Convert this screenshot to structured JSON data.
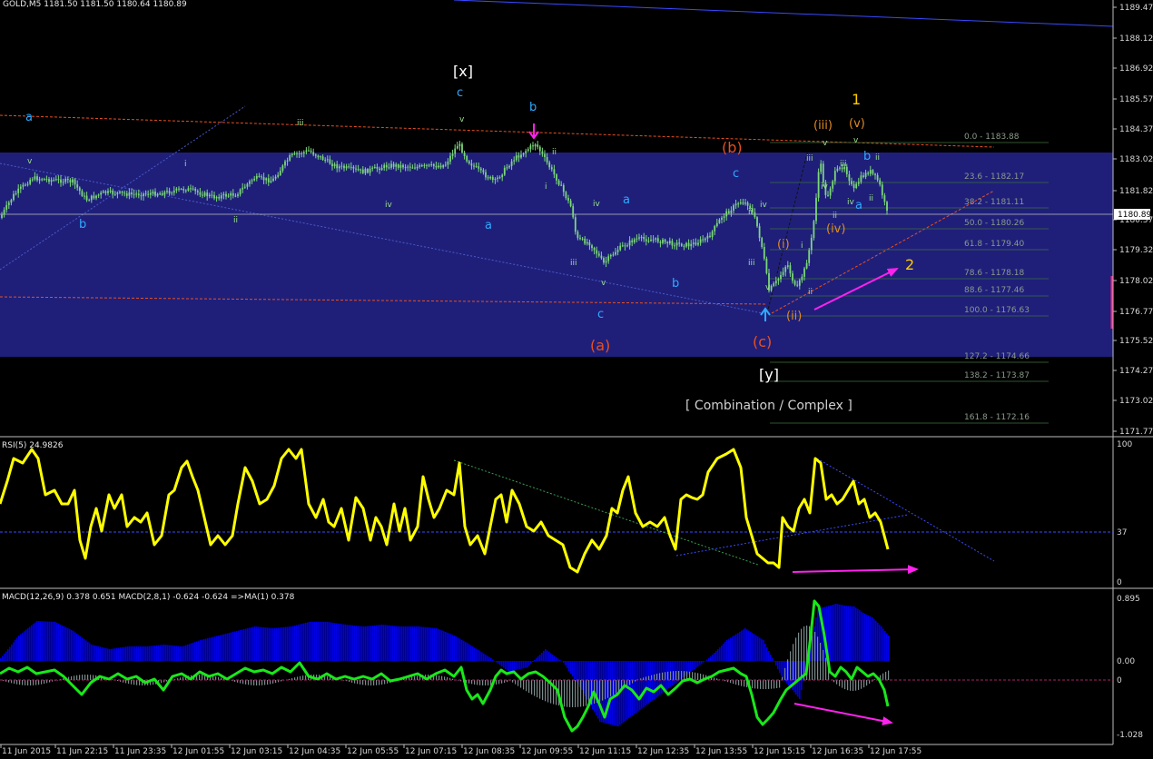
{
  "header": {
    "main": "GOLD,M5  1181.50 1181.50 1180.64 1180.89",
    "rsi": "RSI(5) 24.9826",
    "macd": "MACD(12,26,9) 0.378 0.651  MACD(2,8,1) -0.624 -0.624  =>MA(1) 0.378"
  },
  "price_axis": [
    "1189.47",
    "1188.12",
    "1186.92",
    "1185.57",
    "1184.37",
    "1183.02",
    "1181.82",
    "1180.57",
    "1179.32",
    "1178.02",
    "1176.77",
    "1175.52",
    "1174.27",
    "1173.02",
    "1171.77"
  ],
  "current_price": "1180.89",
  "rsi_axis": [
    "100",
    "37",
    "0"
  ],
  "macd_axis": [
    "0.895",
    "0.00",
    "0",
    "-1.028"
  ],
  "time_axis": [
    "11 Jun 2015",
    "11 Jun 22:15",
    "11 Jun 23:35",
    "12 Jun 01:55",
    "12 Jun 03:15",
    "12 Jun 04:35",
    "12 Jun 05:55",
    "12 Jun 07:15",
    "12 Jun 08:35",
    "12 Jun 09:55",
    "12 Jun 11:15",
    "12 Jun 12:35",
    "12 Jun 13:55",
    "12 Jun 15:15",
    "12 Jun 16:35",
    "12 Jun 17:55"
  ],
  "fib_levels": [
    "0.0 - 1183.88",
    "23.6 - 1182.17",
    "38.2 - 1181.11",
    "50.0 - 1180.26",
    "61.8 - 1179.40",
    "78.6 - 1178.18",
    "88.6 - 1177.46",
    "100.0 - 1176.63",
    "127.2 - 1174.66",
    "138.2 - 1173.87",
    "161.8 - 1172.16"
  ],
  "wave_labels": {
    "x_big": "[x]",
    "y_big": "[y]",
    "a_paren": "(a)",
    "b_paren": "(b)",
    "c_paren": "(c)",
    "a": "a",
    "b": "b",
    "c": "c",
    "one": "1",
    "two": "2",
    "i": "i",
    "ii": "ii",
    "iii": "iii",
    "iv": "iv",
    "v": "v",
    "i_p": "(i)",
    "ii_p": "(ii)",
    "iii_p": "(iii)",
    "iv_p": "(iv)",
    "v_p": "(v)"
  },
  "annotation": "[ Combination / Complex ]",
  "colors": {
    "candles": "#7cd67a",
    "rsi": "#ffff00",
    "macd_signal": "#19e81a",
    "macd_hist": "#0000e8",
    "osma": "#7a8a8a",
    "zone": "#1f1f7a",
    "arrow": "#ff22ee",
    "wave_cyan": "#2eaaff",
    "wave_red": "#e85020",
    "wave_orange": "#e08a20",
    "wave_yellow": "#ffcc00"
  },
  "chart_data": {
    "type": "line",
    "symbol": "GOLD",
    "timeframe": "M5",
    "ylim": [
      1171.3,
      1189.8
    ],
    "x": [
      "11 Jun 2015",
      "11 Jun 22:15",
      "11 Jun 23:35",
      "12 Jun 01:55",
      "12 Jun 03:15",
      "12 Jun 04:35",
      "12 Jun 05:55",
      "12 Jun 07:15",
      "12 Jun 08:35",
      "12 Jun 09:55",
      "12 Jun 11:15",
      "12 Jun 12:35",
      "12 Jun 13:55",
      "12 Jun 15:15",
      "12 Jun 16:35",
      "12 Jun 17:55"
    ],
    "series": [
      {
        "name": "GOLD,M5",
        "values": [
          1180.6,
          1182.2,
          1181.8,
          1181.9,
          1182.6,
          1183.2,
          1182.8,
          1183.0,
          1182.5,
          1183.2,
          1179.2,
          1179.6,
          1181.2,
          1177.0,
          1183.0,
          1180.9
        ]
      },
      {
        "name": "RSI(5)",
        "values": [
          60,
          78,
          48,
          72,
          52,
          86,
          40,
          58,
          85,
          64,
          20,
          42,
          70,
          18,
          84,
          25
        ]
      },
      {
        "name": "MACD(2,8,1)",
        "values": [
          -0.1,
          0.05,
          -0.05,
          0.02,
          0.05,
          0.1,
          -0.05,
          0.05,
          -0.2,
          0.1,
          -0.95,
          -0.4,
          0.05,
          -0.8,
          0.85,
          -0.62
        ]
      }
    ]
  }
}
